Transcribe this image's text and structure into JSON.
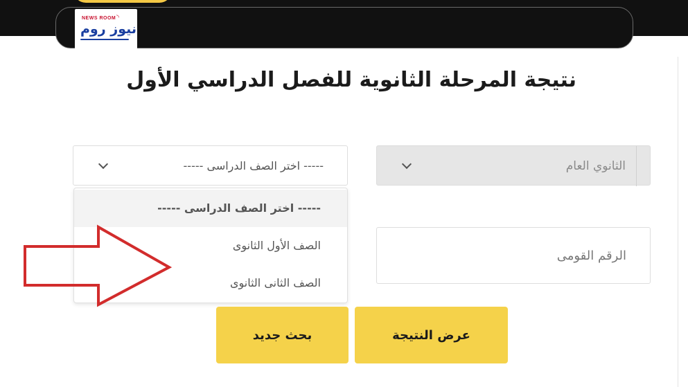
{
  "header": {
    "logo": {
      "small_text": "NEWS ROOM",
      "main_text": "نيوز روم"
    }
  },
  "page": {
    "title": "نتيجة المرحلة الثانوية للفصل الدراسي الأول"
  },
  "form": {
    "stage_select": {
      "value": "الثانوي العام"
    },
    "grade_select": {
      "value": "----- اختر الصف الدراسى -----",
      "options": [
        "----- اختر الصف الدراسى -----",
        "الصف الأول الثانوى",
        "الصف الثانى الثانوى"
      ]
    },
    "national_id": {
      "placeholder": "الرقم القومى",
      "value": ""
    },
    "buttons": {
      "show_result": "عرض النتيجة",
      "new_search": "بحث جديد"
    }
  },
  "colors": {
    "accent": "#f5d24a",
    "header_bg": "#111111",
    "arrow": "#d22c2c",
    "logo_blue": "#1a3fa0",
    "logo_red": "#c8102e"
  },
  "icons": {
    "stage_chevron": "chevron-down-icon",
    "grade_chevron": "chevron-down-icon",
    "annotation_arrow": "arrow-right-icon",
    "logo_wifi": "wifi-icon"
  }
}
